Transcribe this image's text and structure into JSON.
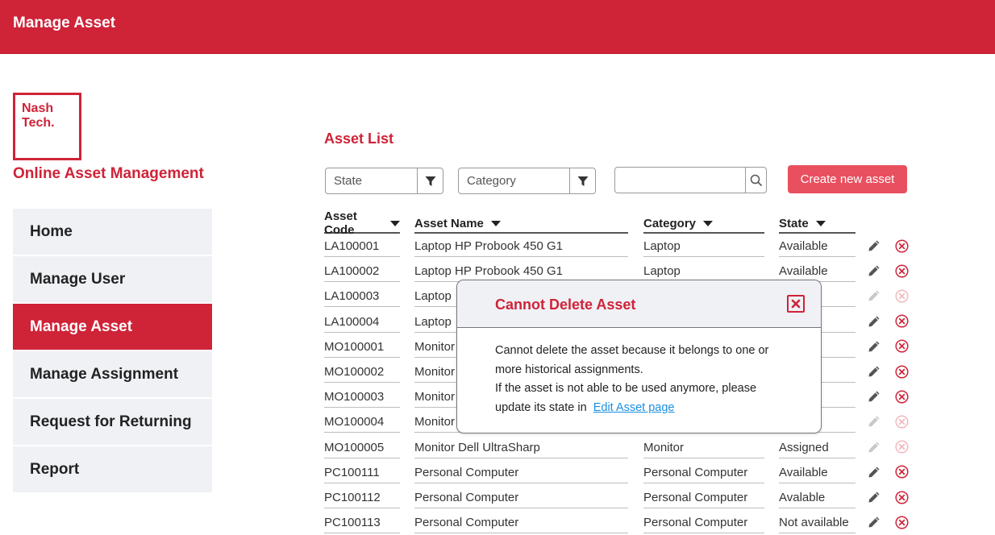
{
  "header": {
    "title": "Manage Asset"
  },
  "brand": {
    "logo_line1": "Nash",
    "logo_line2": "Tech.",
    "app_name": "Online Asset Management"
  },
  "nav": {
    "items": [
      {
        "label": "Home"
      },
      {
        "label": "Manage User"
      },
      {
        "label": "Manage Asset",
        "active": true
      },
      {
        "label": "Manage Assignment"
      },
      {
        "label": "Request for Returning"
      },
      {
        "label": "Report"
      }
    ]
  },
  "page": {
    "heading": "Asset List"
  },
  "filters": {
    "state_label": "State",
    "category_label": "Category",
    "search_value": "",
    "create_button": "Create new asset"
  },
  "table": {
    "headers": {
      "code": "Asset Code",
      "name": "Asset Name",
      "category": "Category",
      "state": "State"
    },
    "rows": [
      {
        "code": "LA100001",
        "name": "Laptop HP Probook 450 G1",
        "category": "Laptop",
        "state": "Available",
        "enabled": true
      },
      {
        "code": "LA100002",
        "name": "Laptop HP Probook 450 G1",
        "category": "Laptop",
        "state": "Available",
        "enabled": true
      },
      {
        "code": "LA100003",
        "name": "Laptop",
        "category": "",
        "state": "d",
        "enabled": false
      },
      {
        "code": "LA100004",
        "name": "Laptop",
        "category": "",
        "state": "ilable",
        "enabled": true
      },
      {
        "code": "MO100001",
        "name": "Monitor",
        "category": "",
        "state": "e",
        "enabled": true
      },
      {
        "code": "MO100002",
        "name": "Monitor",
        "category": "",
        "state": "e",
        "enabled": true
      },
      {
        "code": "MO100003",
        "name": "Monitor",
        "category": "",
        "state": "e",
        "enabled": true
      },
      {
        "code": "MO100004",
        "name": "Monitor",
        "category": "",
        "state": "d",
        "enabled": false
      },
      {
        "code": "MO100005",
        "name": "Monitor Dell UltraSharp",
        "category": "Monitor",
        "state": "Assigned",
        "enabled": false
      },
      {
        "code": "PC100111",
        "name": "Personal Computer",
        "category": "Personal Computer",
        "state": "Available",
        "enabled": true
      },
      {
        "code": "PC100112",
        "name": "Personal Computer",
        "category": "Personal Computer",
        "state": "Avalable",
        "enabled": true
      },
      {
        "code": "PC100113",
        "name": "Personal Computer",
        "category": "Personal Computer",
        "state": "Not available",
        "enabled": true
      }
    ]
  },
  "modal": {
    "title": "Cannot Delete Asset",
    "line1": "Cannot delete the asset because it belongs to one or",
    "line2": "more historical assignments.",
    "line3": "If the asset is not able to be used anymore, please",
    "line4_prefix": "update its state in",
    "link": "Edit Asset page"
  },
  "colors": {
    "brand": "#cf2338",
    "create_button": "#e8505f",
    "link": "#1a8fe0",
    "panel": "#eff1f5"
  },
  "icons": {
    "filter": "funnel-icon",
    "search": "magnifier-icon",
    "edit": "pencil-icon",
    "delete": "circle-x-icon",
    "close": "square-x-icon"
  }
}
